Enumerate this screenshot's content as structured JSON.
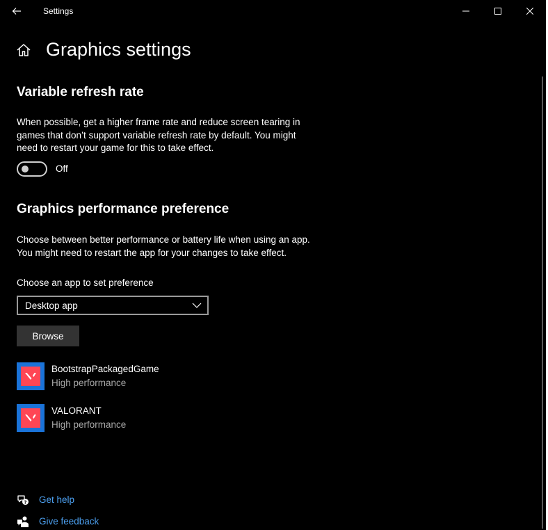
{
  "window": {
    "title": "Settings"
  },
  "page": {
    "title": "Graphics settings"
  },
  "vrr": {
    "heading": "Variable refresh rate",
    "description": "When possible, get a higher frame rate and reduce screen tearing in games that don’t support variable refresh rate by default. You might need to restart your game for this to take effect.",
    "toggle_state": "Off",
    "toggle_on": false
  },
  "perf": {
    "heading": "Graphics performance preference",
    "description_line1": "Choose between better performance or battery life when using an app.",
    "description_line2": "You might need to restart the app for your changes to take effect.",
    "choose_label": "Choose an app to set preference",
    "dropdown_value": "Desktop app",
    "browse_label": "Browse"
  },
  "apps": [
    {
      "name": "BootstrapPackagedGame",
      "preference": "High performance"
    },
    {
      "name": "VALORANT",
      "preference": "High performance"
    }
  ],
  "footer": {
    "help_label": "Get help",
    "feedback_label": "Give feedback"
  },
  "colors": {
    "accent_link": "#4ca0f0",
    "app_icon_bg": "#1a73d9",
    "valorant_red": "#ff4655"
  }
}
